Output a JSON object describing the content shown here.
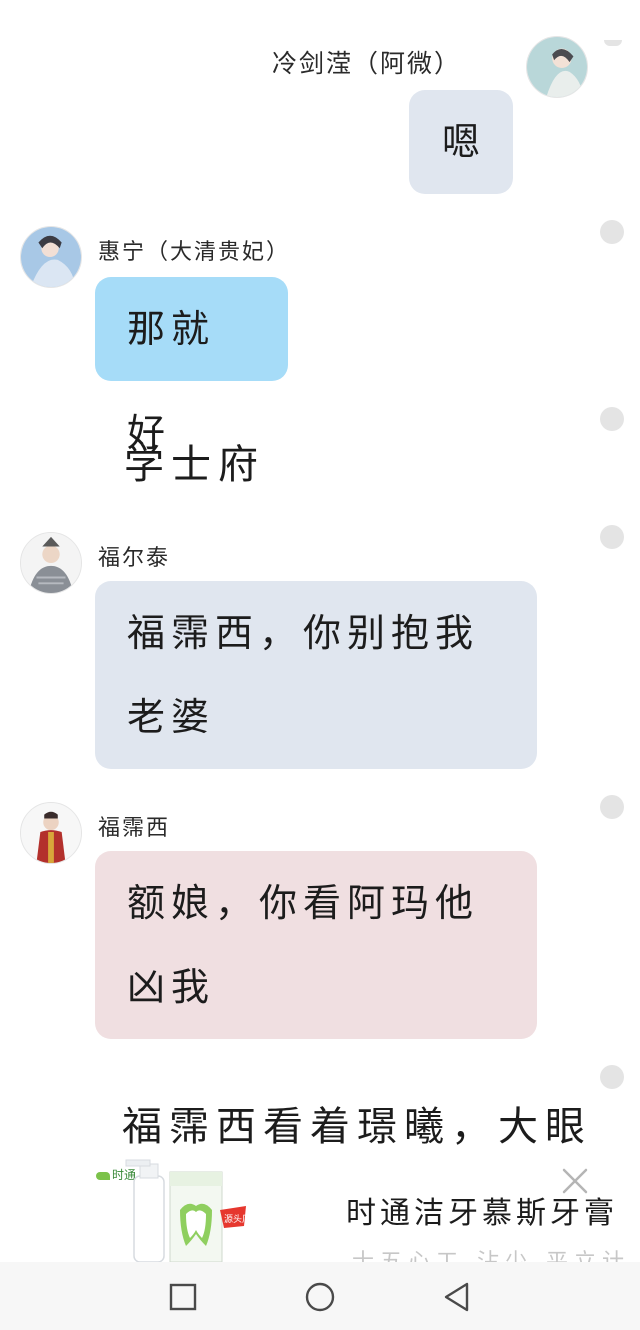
{
  "messages": [
    {
      "sender": "冷剑滢（阿微）",
      "text": "嗯",
      "side": "right"
    },
    {
      "sender": "惠宁（大清贵妃）",
      "text": "那就好",
      "side": "left"
    },
    {
      "narration": "学士府"
    },
    {
      "sender": "福尔泰",
      "lines": [
        "福霈西，你别抱我",
        "老婆"
      ],
      "side": "left"
    },
    {
      "sender": "福霈西",
      "lines": [
        "额娘，你看阿玛他",
        "凶我"
      ],
      "side": "left"
    },
    {
      "narration": "福霈西看着璟曦，大眼"
    }
  ],
  "ad": {
    "brand": "时通",
    "title": "时通洁牙慕斯牙膏",
    "subtitle": "士五心工 沾少 平立计",
    "badge": "源头厂家"
  },
  "navbar": {
    "icons": [
      "square-recent-icon",
      "circle-home-icon",
      "triangle-back-icon"
    ]
  },
  "colors": {
    "bubble_gray": "#e0e6ef",
    "bubble_blue": "#a6dcf8",
    "bubble_pink": "#f0dfe1",
    "side_dot": "#e4e4e4"
  }
}
